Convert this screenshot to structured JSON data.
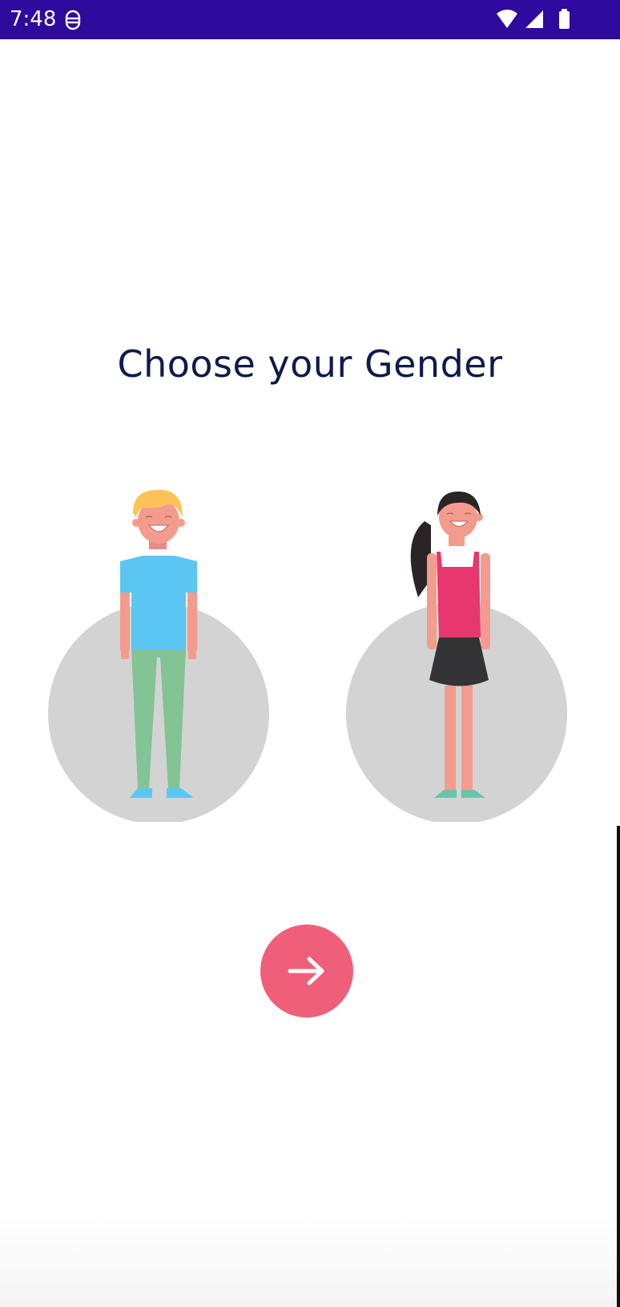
{
  "status_bar": {
    "time": "7:48",
    "icons": [
      "notification-icon",
      "wifi-icon",
      "cellular-signal-icon",
      "battery-icon"
    ],
    "background_color": "#2e0b9c"
  },
  "title": "Choose your Gender",
  "options": [
    {
      "id": "male",
      "icon": "male-avatar-icon"
    },
    {
      "id": "female",
      "icon": "female-avatar-icon"
    }
  ],
  "next_button": {
    "icon": "arrow-right-icon",
    "color": "#f05f7a"
  },
  "colors": {
    "title": "#0d1b4b",
    "avatar_backdrop": "#d3d3d3"
  }
}
